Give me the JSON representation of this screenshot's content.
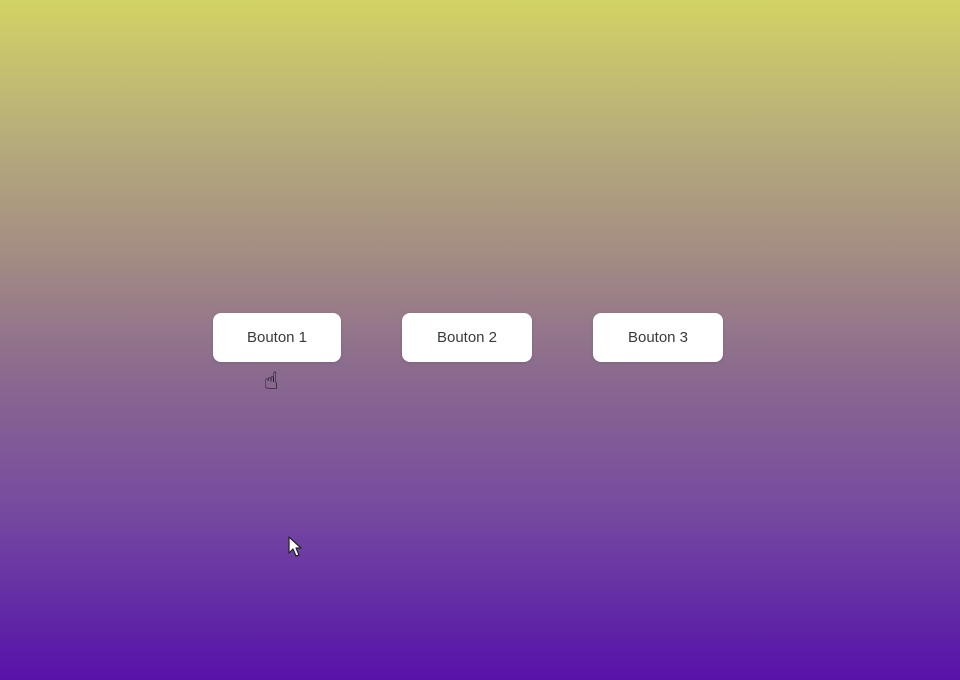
{
  "buttons": [
    {
      "label": "Bouton 1"
    },
    {
      "label": "Bouton 2"
    },
    {
      "label": "Bouton 3"
    }
  ],
  "hover_indicator": {
    "glyph": "☝",
    "icon": "pointing-hand-icon"
  },
  "cursor": {
    "icon": "mouse-arrow-icon"
  },
  "colors": {
    "gradient_top": "#d2d364",
    "gradient_bottom": "#5812a8",
    "button_bg": "#ffffff",
    "button_text": "#3a3a3a"
  }
}
